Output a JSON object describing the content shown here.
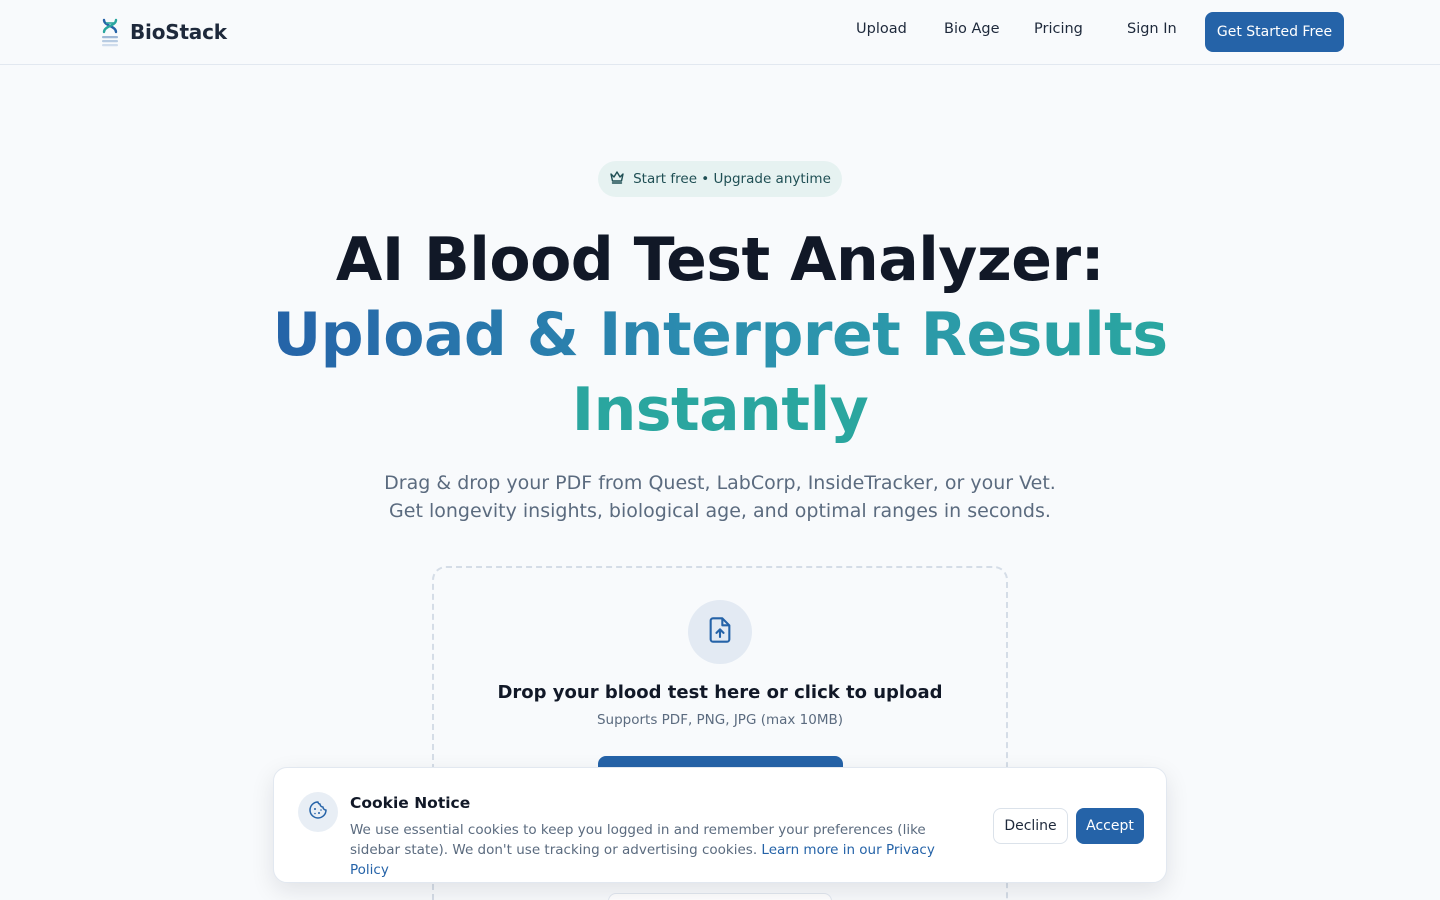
{
  "header": {
    "brand": "BioStack",
    "logo_icon": "dna-icon",
    "nav": [
      {
        "label": "Upload"
      },
      {
        "label": "Bio Age"
      },
      {
        "label": "Pricing"
      },
      {
        "label": "Sign In"
      }
    ],
    "cta_label": "Get Started Free"
  },
  "hero": {
    "badge_icon": "crown-icon",
    "badge_text": "Start free • Upgrade anytime",
    "title_line1": "AI Blood Test Analyzer:",
    "title_line2": "Upload & Interpret Results",
    "title_line3": "Instantly",
    "subtitle_line1": "Drag & drop your PDF from Quest, LabCorp, InsideTracker, or your Vet.",
    "subtitle_line2": "Get longevity insights, biological age, and optimal ranges in seconds."
  },
  "upload": {
    "icon": "file-upload-icon",
    "title": "Drop your blood test here or click to upload",
    "formats": "Supports PDF, PNG, JPG (max 10MB)"
  },
  "cookie": {
    "icon": "cookie-icon",
    "title": "Cookie Notice",
    "text": "We use essential cookies to keep you logged in and remember your preferences (like sidebar state). We don't use tracking or advertising cookies.",
    "link_text": "Learn more in our Privacy Policy",
    "decline_label": "Decline",
    "accept_label": "Accept"
  },
  "colors": {
    "primary": "#2563a8",
    "teal": "#2aa69f",
    "background": "#f8fafc",
    "muted_text": "#5b6b7f"
  }
}
